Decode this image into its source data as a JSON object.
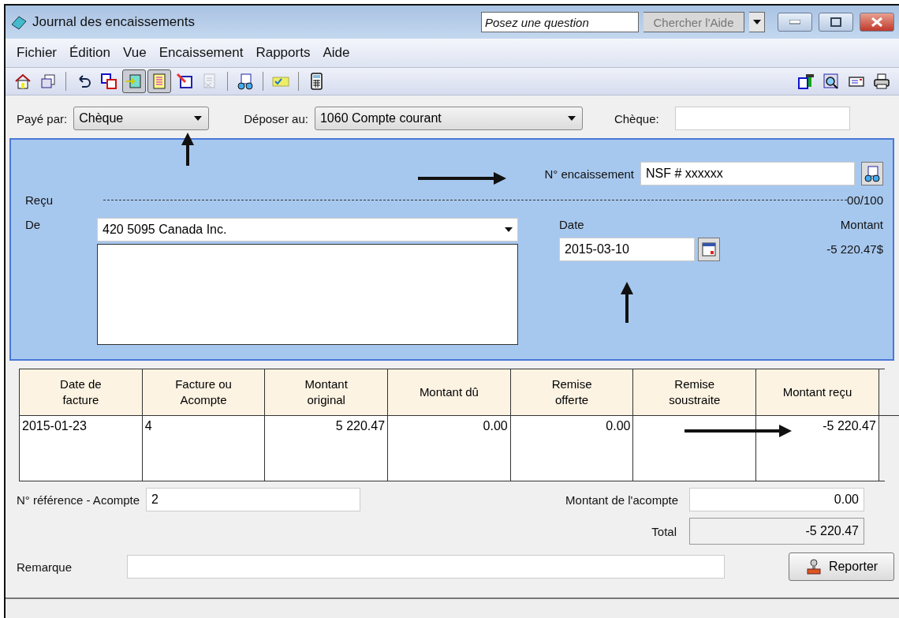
{
  "window": {
    "title": "Journal des encaissements",
    "help_search": {
      "placeholder": "Posez une question",
      "button": "Chercher l'Aide"
    }
  },
  "menu": [
    {
      "label": "Fichier"
    },
    {
      "label": "Édition"
    },
    {
      "label": "Vue"
    },
    {
      "label": "Encaissement"
    },
    {
      "label": "Rapports"
    },
    {
      "label": "Aide"
    }
  ],
  "toolbar": {
    "left": [
      {
        "kind": "button",
        "pressed": false,
        "disabled": false
      },
      {
        "kind": "button",
        "pressed": false,
        "disabled": false
      },
      {
        "kind": "separator"
      },
      {
        "kind": "button",
        "pressed": false,
        "disabled": false
      },
      {
        "kind": "button",
        "pressed": false,
        "disabled": false
      },
      {
        "kind": "button",
        "pressed": true,
        "disabled": false
      },
      {
        "kind": "button",
        "pressed": true,
        "disabled": false
      },
      {
        "kind": "button",
        "pressed": false,
        "disabled": false
      },
      {
        "kind": "button",
        "pressed": false,
        "disabled": true
      },
      {
        "kind": "separator"
      },
      {
        "kind": "button",
        "pressed": false,
        "disabled": false
      },
      {
        "kind": "separator"
      },
      {
        "kind": "button",
        "pressed": false,
        "disabled": false
      },
      {
        "kind": "separator"
      },
      {
        "kind": "button",
        "pressed": false,
        "disabled": false
      }
    ],
    "right": [
      {
        "kind": "button",
        "pressed": false,
        "disabled": false
      },
      {
        "kind": "button",
        "pressed": false,
        "disabled": false
      },
      {
        "kind": "button",
        "pressed": false,
        "disabled": false
      },
      {
        "kind": "button",
        "pressed": false,
        "disabled": false
      }
    ]
  },
  "payment": {
    "paid_by_label": "Payé par:",
    "paid_by": "Chèque",
    "deposit_label": "Déposer au:",
    "deposit": "1060 Compte courant",
    "cheque_label": "Chèque:"
  },
  "receipt": {
    "number_label": "N° encaissement",
    "number": "NSF # xxxxxx",
    "received_label": "Reçu",
    "cents": "00/100",
    "from_label": "De",
    "from": "420 5095 Canada Inc.",
    "date_label": "Date",
    "date": "2015-03-10",
    "amount_label": "Montant",
    "amount": "-5 220.47$"
  },
  "table": {
    "columns": [
      "Date de facture",
      "Facture ou Acompte",
      "Montant original",
      "Montant dû",
      "Remise offerte",
      "Remise soustraite",
      "Montant reçu"
    ],
    "rows": [
      [
        "2015-01-23",
        "4",
        "5 220.47",
        "0.00",
        "0.00",
        "",
        "-5 220.47"
      ]
    ]
  },
  "footer": {
    "reference_label": "N° référence - Acompte",
    "reference": "2",
    "deposit_amount_label": "Montant de l'acompte",
    "deposit_amount": "0.00",
    "total_label": "Total",
    "total": "-5 220.47",
    "remark_label": "Remarque",
    "post_button": "Reporter"
  }
}
